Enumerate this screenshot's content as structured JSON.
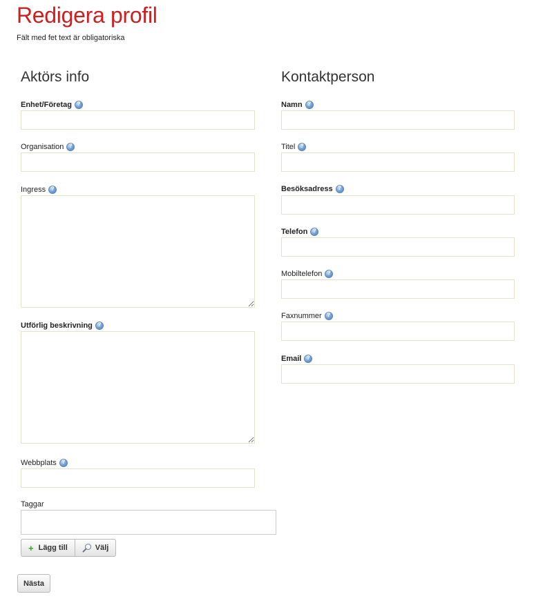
{
  "page": {
    "title": "Redigera profil",
    "subtitle": "Fält med fet text är obligatoriska"
  },
  "left": {
    "heading": "Aktörs info",
    "fields": {
      "enhet": {
        "label": "Enhet/Företag",
        "value": ""
      },
      "organisation": {
        "label": "Organisation",
        "value": ""
      },
      "ingress": {
        "label": "Ingress",
        "value": ""
      },
      "beskrivning": {
        "label": "Utförlig beskrivning",
        "value": ""
      },
      "webbplats": {
        "label": "Webbplats",
        "value": ""
      },
      "taggar": {
        "label": "Taggar",
        "value": ""
      }
    },
    "buttons": {
      "add": "Lägg till",
      "choose": "Välj"
    }
  },
  "right": {
    "heading": "Kontaktperson",
    "fields": {
      "namn": {
        "label": "Namn",
        "value": ""
      },
      "titel": {
        "label": "Titel",
        "value": ""
      },
      "besoksadress": {
        "label": "Besöksadress",
        "value": ""
      },
      "telefon": {
        "label": "Telefon",
        "value": ""
      },
      "mobiltelefon": {
        "label": "Mobiltelefon",
        "value": ""
      },
      "faxnummer": {
        "label": "Faxnummer",
        "value": ""
      },
      "email": {
        "label": "Email",
        "value": ""
      }
    }
  },
  "footer": {
    "next": "Nästa"
  },
  "colors": {
    "title": "#cc1f1f",
    "field_border": "#e5e2cc",
    "help_icon": "#5d86be",
    "add_icon": "#2fa52f"
  },
  "icons": {
    "help": "help-icon",
    "add": "plus-icon",
    "choose": "magnifier-icon"
  }
}
